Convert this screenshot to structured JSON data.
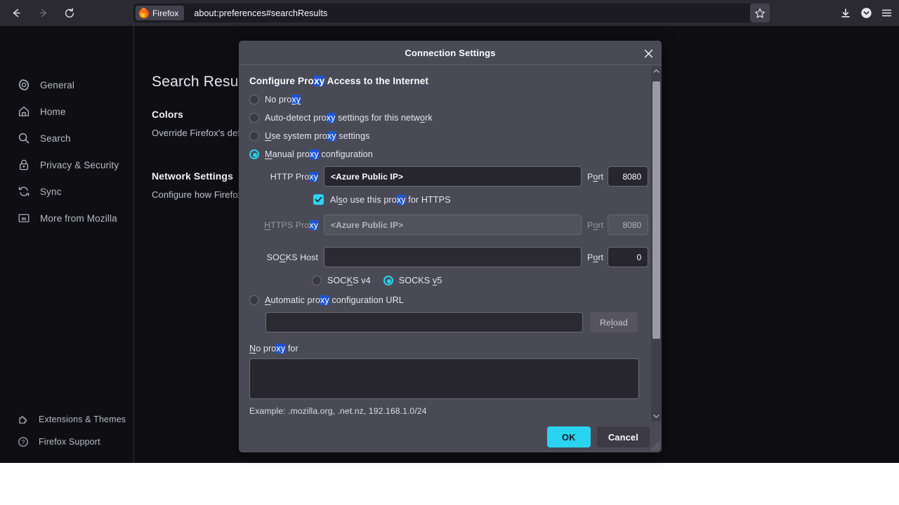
{
  "browser": {
    "nav": {
      "back": "back-arrow",
      "forward": "forward-arrow",
      "reload": "reload-arrow"
    },
    "urlbar": {
      "chip_label": "Firefox",
      "url": "about:preferences#searchResults"
    },
    "toolbar_icons": [
      "bookmark-star",
      "downloads",
      "pocket",
      "app-menu"
    ]
  },
  "sidebar": {
    "top_items": [
      {
        "label": "General",
        "icon": "gear-icon"
      },
      {
        "label": "Home",
        "icon": "home-icon"
      },
      {
        "label": "Search",
        "icon": "search-icon"
      },
      {
        "label": "Privacy & Security",
        "icon": "lock-icon"
      },
      {
        "label": "Sync",
        "icon": "sync-icon"
      },
      {
        "label": "More from Mozilla",
        "icon": "mozilla-icon"
      }
    ],
    "bottom_items": [
      {
        "label": "Extensions & Themes",
        "icon": "puzzle-icon"
      },
      {
        "label": "Firefox Support",
        "icon": "question-icon"
      }
    ]
  },
  "content": {
    "title": "Search Results",
    "sections": [
      {
        "heading": "Colors",
        "body": "Override Firefox's defau"
      },
      {
        "heading": "Network Settings",
        "body": "Configure how Firefox c"
      }
    ]
  },
  "dialog": {
    "title": "Connection Settings",
    "close_icon": "close-icon",
    "heading": "Configure Proxy Access to the Internet",
    "heading_parts": {
      "pre": "Configure Pro",
      "hl": "xy",
      "post": " Access to the Internet"
    },
    "radios": [
      {
        "name": "no-proxy",
        "pre": "No pro",
        "hl": "xy",
        "post": "",
        "underline": "",
        "selected": false
      },
      {
        "name": "auto-detect",
        "pre": "Auto-detect pro",
        "hl": "xy",
        "post": " settings for this netw",
        "underline2": "o",
        "post2": "rk",
        "selected": false
      },
      {
        "name": "use-system",
        "underline": "U",
        "pre": "se system pro",
        "hl": "xy",
        "post": " settings",
        "selected": false
      },
      {
        "name": "manual",
        "underline": "M",
        "pre": "anual pro",
        "hl": "xy",
        "post": " configuration",
        "selected": true
      }
    ],
    "http_proxy": {
      "label_pre": "HTTP Pro",
      "label_hl": "xy",
      "value": "<Azure Public IP>",
      "port_label": "Port",
      "port_underline": "o",
      "port_value": "8080"
    },
    "also_https": {
      "label_pre": "Al",
      "label_underline": "s",
      "label_mid": "o use this pro",
      "label_hl": "xy",
      "label_post": " for HTTPS",
      "checked": true
    },
    "https_proxy": {
      "label_underline": "H",
      "label_pre": "TTPS Pro",
      "label_hl": "xy",
      "value": "<Azure Public IP>",
      "port_label": "Port",
      "port_value": "8080",
      "disabled": true
    },
    "socks_host": {
      "label_pre": "SO",
      "label_underline": "C",
      "label_post": "KS Host",
      "value": "",
      "port_label": "Port",
      "port_value": "0"
    },
    "socks_version": {
      "v4_pre": "SOC",
      "v4_underline": "K",
      "v4_post": "S v4",
      "v5_pre": "SOCKS ",
      "v5_underline": "v",
      "v5_post": "5",
      "selected": "v5"
    },
    "auto_config": {
      "underline": "A",
      "pre": "utomatic pro",
      "hl": "xy",
      "post": " configuration URL",
      "url_value": "",
      "reload_pre": "Re",
      "reload_underline": "l",
      "reload_post": "oad",
      "selected": false
    },
    "no_proxy_for": {
      "underline": "N",
      "pre": "o pro",
      "hl": "xy",
      "post": " for",
      "value": ""
    },
    "example": "Example: .mozilla.org, .net.nz, 192.168.1.0/24",
    "buttons": {
      "ok": "OK",
      "cancel": "Cancel"
    },
    "accent_color": "#2ad4f0",
    "highlight_color": "#1c55d4"
  }
}
